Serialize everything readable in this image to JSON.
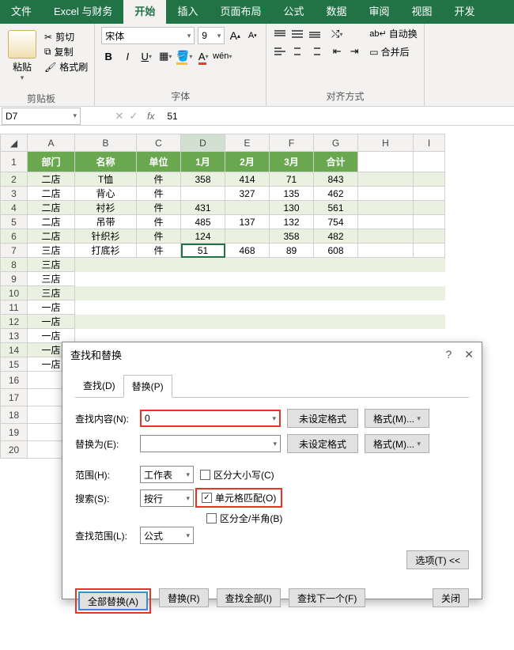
{
  "tabs": [
    "文件",
    "Excel 与财务",
    "开始",
    "插入",
    "页面布局",
    "公式",
    "数据",
    "审阅",
    "视图",
    "开发"
  ],
  "active_tab": 2,
  "ribbon": {
    "paste": "粘贴",
    "cut": "剪切",
    "copy": "复制",
    "fmtpainter": "格式刷",
    "clipboard_label": "剪贴板",
    "font_name": "宋体",
    "font_size": "9",
    "font_label": "字体",
    "align_label": "对齐方式",
    "autowrap": "自动换",
    "merge": "合并后"
  },
  "formula_bar": {
    "cell": "D7",
    "value": "51"
  },
  "chart_data": {
    "type": "table",
    "columns": [
      "A",
      "B",
      "C",
      "D",
      "E",
      "F",
      "G",
      "H",
      "I"
    ],
    "headers": [
      "部门",
      "名称",
      "单位",
      "1月",
      "2月",
      "3月",
      "合计"
    ],
    "rows": [
      [
        "二店",
        "T恤",
        "件",
        "358",
        "414",
        "71",
        "843"
      ],
      [
        "二店",
        "背心",
        "件",
        "",
        "327",
        "135",
        "462"
      ],
      [
        "二店",
        "衬衫",
        "件",
        "431",
        "",
        "130",
        "561"
      ],
      [
        "二店",
        "吊带",
        "件",
        "485",
        "137",
        "132",
        "754"
      ],
      [
        "二店",
        "针织衫",
        "件",
        "124",
        "",
        "358",
        "482"
      ],
      [
        "三店",
        "打底衫",
        "件",
        "51",
        "468",
        "89",
        "608"
      ],
      [
        "三店",
        "",
        "",
        "",
        "",
        "",
        ""
      ],
      [
        "三店",
        "",
        "",
        "",
        "",
        "",
        ""
      ],
      [
        "三店",
        "",
        "",
        "",
        "",
        "",
        ""
      ],
      [
        "一店",
        "",
        "",
        "",
        "",
        "",
        ""
      ],
      [
        "一店",
        "",
        "",
        "",
        "",
        "",
        ""
      ],
      [
        "一店",
        "",
        "",
        "",
        "",
        "",
        ""
      ],
      [
        "一店",
        "",
        "",
        "",
        "",
        "",
        ""
      ],
      [
        "一店",
        "",
        "",
        "",
        "",
        "",
        ""
      ]
    ],
    "extra_rows": [
      16,
      17,
      18,
      19,
      20
    ]
  },
  "dialog": {
    "title": "查找和替换",
    "tab_find": "查找(D)",
    "tab_replace": "替换(P)",
    "find_label": "查找内容(N):",
    "find_value": "0",
    "replace_label": "替换为(E):",
    "no_format": "未设定格式",
    "format_btn": "格式(M)...",
    "scope_label": "范围(H):",
    "scope_val": "工作表",
    "match_case": "区分大小写(C)",
    "match_cell": "单元格匹配(O)",
    "search_label": "搜索(S):",
    "search_val": "按行",
    "match_byte": "区分全/半角(B)",
    "lookin_label": "查找范围(L):",
    "lookin_val": "公式",
    "options_btn": "选项(T) <<",
    "replace_all": "全部替换(A)",
    "replace_one": "替换(R)",
    "find_all": "查找全部(I)",
    "find_next": "查找下一个(F)",
    "close": "关闭"
  }
}
